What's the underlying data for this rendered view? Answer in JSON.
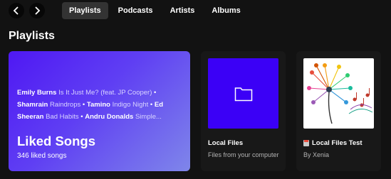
{
  "nav": {
    "back_icon": "chevron-left-icon",
    "forward_icon": "chevron-right-icon"
  },
  "tabs": [
    {
      "label": "Playlists",
      "active": true
    },
    {
      "label": "Podcasts",
      "active": false
    },
    {
      "label": "Artists",
      "active": false
    },
    {
      "label": "Albums",
      "active": false
    }
  ],
  "section": {
    "title": "Playlists"
  },
  "liked": {
    "preview": [
      {
        "artist": "Emily Burns",
        "song": "Is It Just Me? (feat. JP Cooper)"
      },
      {
        "artist": "Shamrain",
        "song": "Raindrops"
      },
      {
        "artist": "Tamino",
        "song": "Indigo Night"
      },
      {
        "artist": "Ed Sheeran",
        "song": "Bad Habits"
      },
      {
        "artist": "Andru Donalds",
        "song": "Simple..."
      }
    ],
    "title": "Liked Songs",
    "count": "346 liked songs",
    "gradient_start": "#4f18f3",
    "gradient_end": "#7f86ea"
  },
  "cards": [
    {
      "title": "Local Files",
      "subtitle": "Files from your computer",
      "cover": "folder-icon",
      "cover_color": "#3b00f6"
    },
    {
      "title": "Local Files Test",
      "subtitle": "By Xenia",
      "cover": "dandelion-music-art",
      "icon": "local-file-icon"
    }
  ],
  "colors": {
    "background": "#121212",
    "card": "#181818",
    "tab_active": "#333333",
    "muted_text": "#b3b3b3"
  }
}
